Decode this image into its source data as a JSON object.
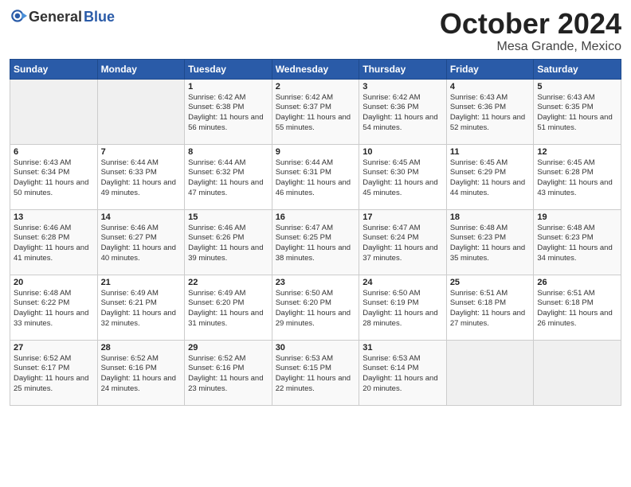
{
  "header": {
    "logo_general": "General",
    "logo_blue": "Blue",
    "month": "October 2024",
    "location": "Mesa Grande, Mexico"
  },
  "days_of_week": [
    "Sunday",
    "Monday",
    "Tuesday",
    "Wednesday",
    "Thursday",
    "Friday",
    "Saturday"
  ],
  "weeks": [
    [
      {
        "day": "",
        "info": ""
      },
      {
        "day": "",
        "info": ""
      },
      {
        "day": "1",
        "info": "Sunrise: 6:42 AM\nSunset: 6:38 PM\nDaylight: 11 hours and 56 minutes."
      },
      {
        "day": "2",
        "info": "Sunrise: 6:42 AM\nSunset: 6:37 PM\nDaylight: 11 hours and 55 minutes."
      },
      {
        "day": "3",
        "info": "Sunrise: 6:42 AM\nSunset: 6:36 PM\nDaylight: 11 hours and 54 minutes."
      },
      {
        "day": "4",
        "info": "Sunrise: 6:43 AM\nSunset: 6:36 PM\nDaylight: 11 hours and 52 minutes."
      },
      {
        "day": "5",
        "info": "Sunrise: 6:43 AM\nSunset: 6:35 PM\nDaylight: 11 hours and 51 minutes."
      }
    ],
    [
      {
        "day": "6",
        "info": "Sunrise: 6:43 AM\nSunset: 6:34 PM\nDaylight: 11 hours and 50 minutes."
      },
      {
        "day": "7",
        "info": "Sunrise: 6:44 AM\nSunset: 6:33 PM\nDaylight: 11 hours and 49 minutes."
      },
      {
        "day": "8",
        "info": "Sunrise: 6:44 AM\nSunset: 6:32 PM\nDaylight: 11 hours and 47 minutes."
      },
      {
        "day": "9",
        "info": "Sunrise: 6:44 AM\nSunset: 6:31 PM\nDaylight: 11 hours and 46 minutes."
      },
      {
        "day": "10",
        "info": "Sunrise: 6:45 AM\nSunset: 6:30 PM\nDaylight: 11 hours and 45 minutes."
      },
      {
        "day": "11",
        "info": "Sunrise: 6:45 AM\nSunset: 6:29 PM\nDaylight: 11 hours and 44 minutes."
      },
      {
        "day": "12",
        "info": "Sunrise: 6:45 AM\nSunset: 6:28 PM\nDaylight: 11 hours and 43 minutes."
      }
    ],
    [
      {
        "day": "13",
        "info": "Sunrise: 6:46 AM\nSunset: 6:28 PM\nDaylight: 11 hours and 41 minutes."
      },
      {
        "day": "14",
        "info": "Sunrise: 6:46 AM\nSunset: 6:27 PM\nDaylight: 11 hours and 40 minutes."
      },
      {
        "day": "15",
        "info": "Sunrise: 6:46 AM\nSunset: 6:26 PM\nDaylight: 11 hours and 39 minutes."
      },
      {
        "day": "16",
        "info": "Sunrise: 6:47 AM\nSunset: 6:25 PM\nDaylight: 11 hours and 38 minutes."
      },
      {
        "day": "17",
        "info": "Sunrise: 6:47 AM\nSunset: 6:24 PM\nDaylight: 11 hours and 37 minutes."
      },
      {
        "day": "18",
        "info": "Sunrise: 6:48 AM\nSunset: 6:23 PM\nDaylight: 11 hours and 35 minutes."
      },
      {
        "day": "19",
        "info": "Sunrise: 6:48 AM\nSunset: 6:23 PM\nDaylight: 11 hours and 34 minutes."
      }
    ],
    [
      {
        "day": "20",
        "info": "Sunrise: 6:48 AM\nSunset: 6:22 PM\nDaylight: 11 hours and 33 minutes."
      },
      {
        "day": "21",
        "info": "Sunrise: 6:49 AM\nSunset: 6:21 PM\nDaylight: 11 hours and 32 minutes."
      },
      {
        "day": "22",
        "info": "Sunrise: 6:49 AM\nSunset: 6:20 PM\nDaylight: 11 hours and 31 minutes."
      },
      {
        "day": "23",
        "info": "Sunrise: 6:50 AM\nSunset: 6:20 PM\nDaylight: 11 hours and 29 minutes."
      },
      {
        "day": "24",
        "info": "Sunrise: 6:50 AM\nSunset: 6:19 PM\nDaylight: 11 hours and 28 minutes."
      },
      {
        "day": "25",
        "info": "Sunrise: 6:51 AM\nSunset: 6:18 PM\nDaylight: 11 hours and 27 minutes."
      },
      {
        "day": "26",
        "info": "Sunrise: 6:51 AM\nSunset: 6:18 PM\nDaylight: 11 hours and 26 minutes."
      }
    ],
    [
      {
        "day": "27",
        "info": "Sunrise: 6:52 AM\nSunset: 6:17 PM\nDaylight: 11 hours and 25 minutes."
      },
      {
        "day": "28",
        "info": "Sunrise: 6:52 AM\nSunset: 6:16 PM\nDaylight: 11 hours and 24 minutes."
      },
      {
        "day": "29",
        "info": "Sunrise: 6:52 AM\nSunset: 6:16 PM\nDaylight: 11 hours and 23 minutes."
      },
      {
        "day": "30",
        "info": "Sunrise: 6:53 AM\nSunset: 6:15 PM\nDaylight: 11 hours and 22 minutes."
      },
      {
        "day": "31",
        "info": "Sunrise: 6:53 AM\nSunset: 6:14 PM\nDaylight: 11 hours and 20 minutes."
      },
      {
        "day": "",
        "info": ""
      },
      {
        "day": "",
        "info": ""
      }
    ]
  ]
}
